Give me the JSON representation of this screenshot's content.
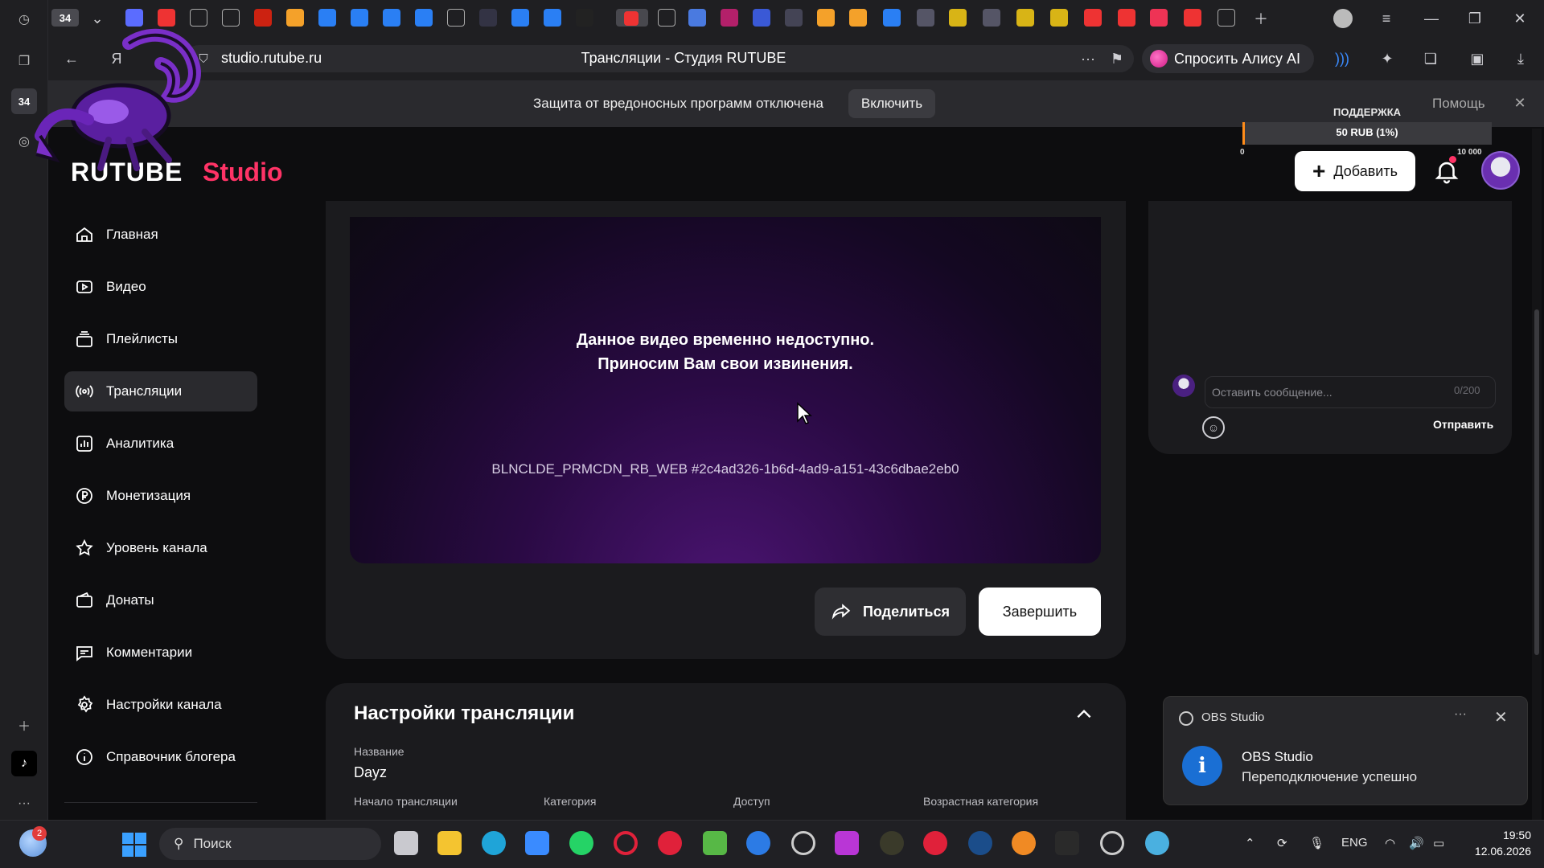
{
  "browser": {
    "tab_counter": "34",
    "rail_counter": "34",
    "url": "studio.rutube.ru",
    "page_title": "Трансляции - Студия RUTUBE",
    "alice_label": "Спросить Алису AI",
    "warning_text": "Защита от вредоносных программ отключена",
    "warning_button": "Включить",
    "help_label": "Помощь"
  },
  "donation_widget": {
    "title": "ПОДДЕРЖКА",
    "progress_text": "50 RUB (1%)",
    "min": "0",
    "max": "10 000",
    "progress_fraction": 0.01,
    "fill_color": "#ff8c1a"
  },
  "header": {
    "logo_text": "RUTUBE",
    "logo_suffix": "Studio",
    "add_button": "Добавить",
    "brand_color": "#ff3366"
  },
  "sidebar": {
    "items": [
      {
        "label": "Главная",
        "icon": "home-icon"
      },
      {
        "label": "Видео",
        "icon": "video-icon"
      },
      {
        "label": "Плейлисты",
        "icon": "playlist-icon"
      },
      {
        "label": "Трансляции",
        "icon": "broadcast-icon",
        "active": true
      },
      {
        "label": "Аналитика",
        "icon": "analytics-icon"
      },
      {
        "label": "Монетизация",
        "icon": "ruble-icon"
      },
      {
        "label": "Уровень канала",
        "icon": "star-icon"
      },
      {
        "label": "Донаты",
        "icon": "wallet-icon"
      },
      {
        "label": "Комментарии",
        "icon": "comment-icon"
      },
      {
        "label": "Настройки канала",
        "icon": "gear-icon"
      },
      {
        "label": "Справочник блогера",
        "icon": "info-icon"
      }
    ]
  },
  "player": {
    "message_line1": "Данное видео временно недоступно.",
    "message_line2": "Приносим Вам свои извинения.",
    "error_code": "BLNCLDE_PRMCDN_RB_WEB #2c4ad326-1b6d-4ad9-a151-43c6dbae2eb0"
  },
  "actions": {
    "share": "Поделиться",
    "finish": "Завершить"
  },
  "settings": {
    "title": "Настройки трансляции",
    "name_label": "Название",
    "name_value": "Dayz",
    "fields": [
      "Начало трансляции",
      "Категория",
      "Доступ",
      "Возрастная категория"
    ]
  },
  "chat": {
    "placeholder": "Оставить сообщение...",
    "counter": "0/200",
    "send": "Отправить"
  },
  "notification": {
    "app": "OBS Studio",
    "title": "OBS Studio",
    "body": "Переподключение успешно",
    "more": "···"
  },
  "taskbar": {
    "weather_badge": "2",
    "search_placeholder": "Поиск",
    "language": "ENG",
    "time": "19:50",
    "date": "12.06.2026"
  }
}
